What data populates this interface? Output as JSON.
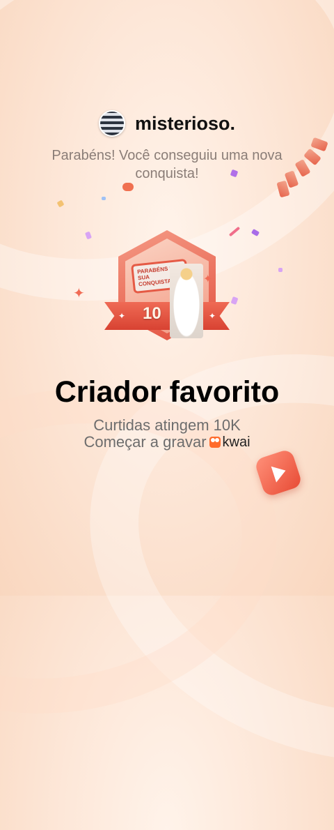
{
  "user": {
    "name": "misterioso."
  },
  "congrats_text": "Parabéns! Você conseguiu uma nova conquista!",
  "badge": {
    "card_text": "PARABÉNS POR SUA CONQUISTA",
    "number": "10"
  },
  "achievement": {
    "title": "Criador favorito",
    "description": "Curtidas atingem 10K",
    "cta": "Começar a gravar",
    "brand": "kwai"
  },
  "icons": [
    "avatar-image",
    "kwai-logo-icon",
    "play-icon",
    "sparkle-icon",
    "star-icon"
  ],
  "colors": {
    "accent": "#e55a45",
    "title": "#000000",
    "muted": "#8a7d77"
  }
}
